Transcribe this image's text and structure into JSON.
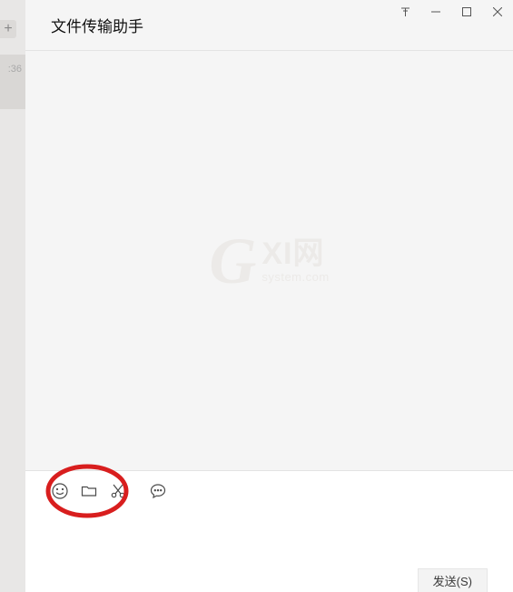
{
  "sidebar": {
    "add_label": "+",
    "time_label": ":36"
  },
  "header": {
    "title": "文件传输助手"
  },
  "watermark": {
    "g": "G",
    "xi": "XI网",
    "sub": "system.com"
  },
  "toolbar": {
    "emoji_name": "emoji-icon",
    "folder_name": "folder-icon",
    "scissors_name": "scissors-icon",
    "chat_name": "chat-history-icon"
  },
  "input": {
    "placeholder": ""
  },
  "send": {
    "label": "发送(S)"
  }
}
